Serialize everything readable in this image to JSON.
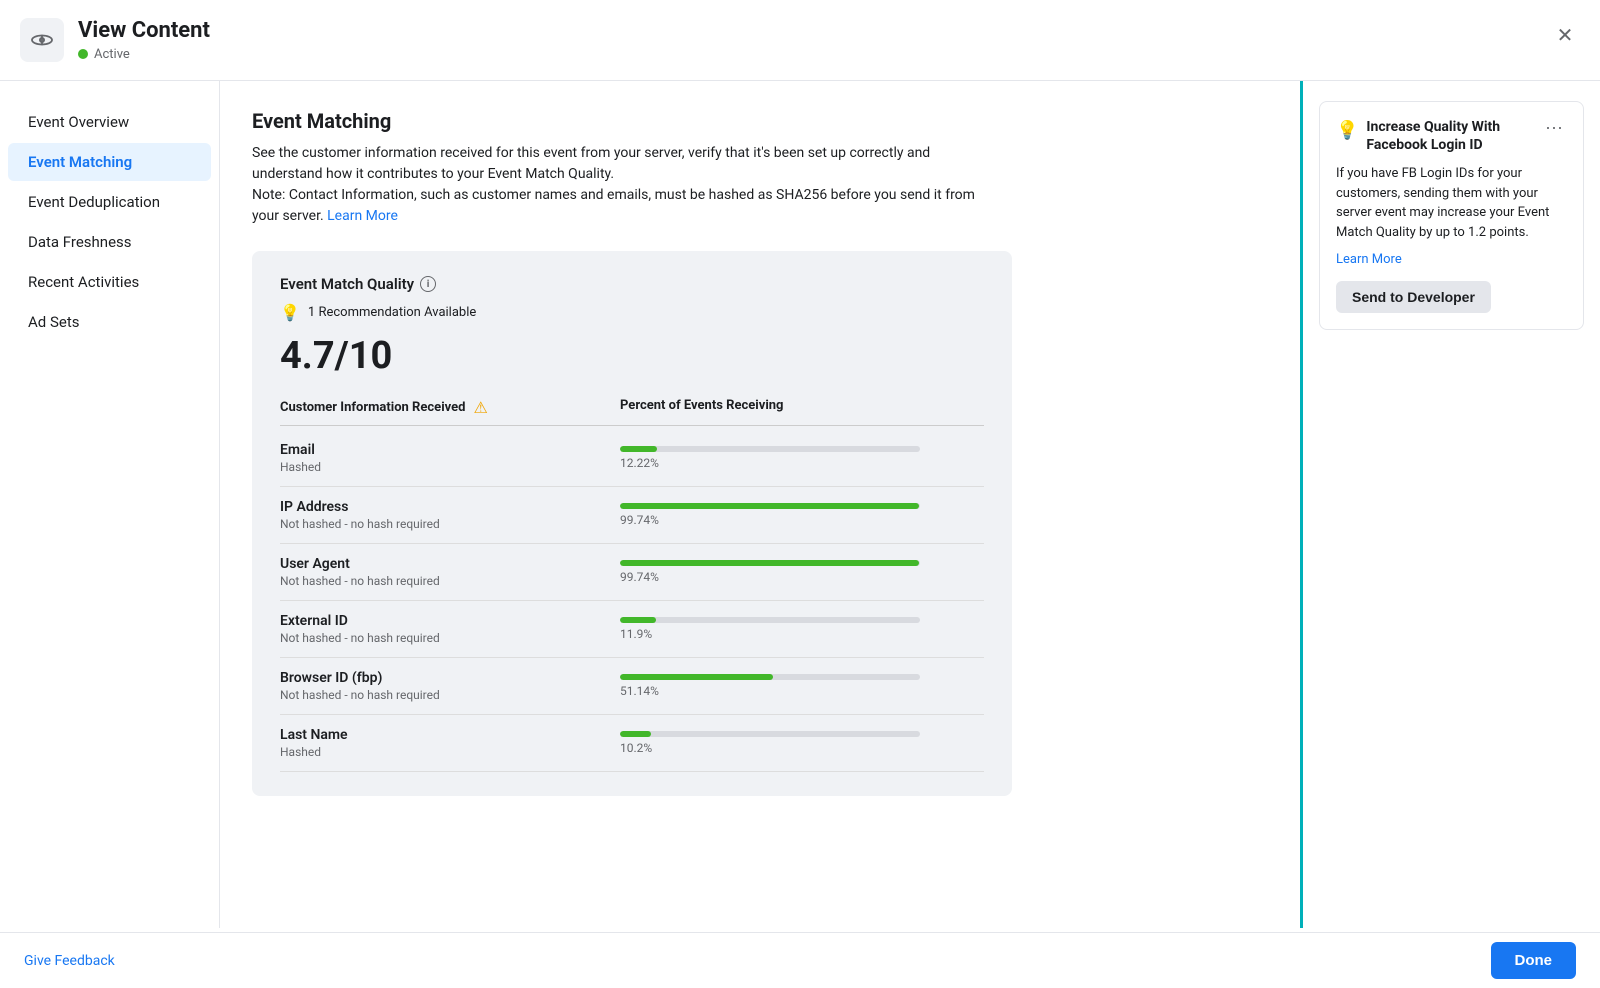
{
  "header": {
    "title": "View Content",
    "status": "Active",
    "close_label": "×"
  },
  "sidebar": {
    "items": [
      {
        "id": "event-overview",
        "label": "Event Overview",
        "active": false
      },
      {
        "id": "event-matching",
        "label": "Event Matching",
        "active": true
      },
      {
        "id": "event-deduplication",
        "label": "Event Deduplication",
        "active": false
      },
      {
        "id": "data-freshness",
        "label": "Data Freshness",
        "active": false
      },
      {
        "id": "recent-activities",
        "label": "Recent Activities",
        "active": false
      },
      {
        "id": "ad-sets",
        "label": "Ad Sets",
        "active": false
      }
    ]
  },
  "main": {
    "section_title": "Event Matching",
    "section_desc_1": "See the customer information received for this event from your server, verify that it's been set up correctly and understand how it contributes to your Event Match Quality.",
    "section_desc_2": "Note: Contact Information, such as customer names and emails, must be hashed as SHA256 before you send it from your server.",
    "learn_more_text": "Learn More",
    "quality_card": {
      "title": "Event Match Quality",
      "recommendation_count": "1 Recommendation Available",
      "score": "4.7/10",
      "table_header_col1": "Customer Information Received",
      "table_header_col2": "Percent of Events Receiving",
      "rows": [
        {
          "label": "Email",
          "sublabel": "Hashed",
          "percent": 12.22,
          "percent_text": "12.22%"
        },
        {
          "label": "IP Address",
          "sublabel": "Not hashed - no hash required",
          "percent": 99.74,
          "percent_text": "99.74%"
        },
        {
          "label": "User Agent",
          "sublabel": "Not hashed - no hash required",
          "percent": 99.74,
          "percent_text": "99.74%"
        },
        {
          "label": "External ID",
          "sublabel": "Not hashed - no hash required",
          "percent": 11.9,
          "percent_text": "11.9%"
        },
        {
          "label": "Browser ID (fbp)",
          "sublabel": "Not hashed - no hash required",
          "percent": 51.14,
          "percent_text": "51.14%"
        },
        {
          "label": "Last Name",
          "sublabel": "Hashed",
          "percent": 10.2,
          "percent_text": "10.2%"
        }
      ]
    }
  },
  "right_panel": {
    "tip_title": "Increase Quality With Facebook Login ID",
    "tip_body": "If you have FB Login IDs for your customers, sending them with your server event may increase your Event Match Quality by up to 1.2 points.",
    "learn_more_text": "Learn More",
    "send_btn_label": "Send to Developer",
    "menu_icon": "···"
  },
  "footer": {
    "feedback_label": "Give Feedback",
    "done_label": "Done"
  }
}
